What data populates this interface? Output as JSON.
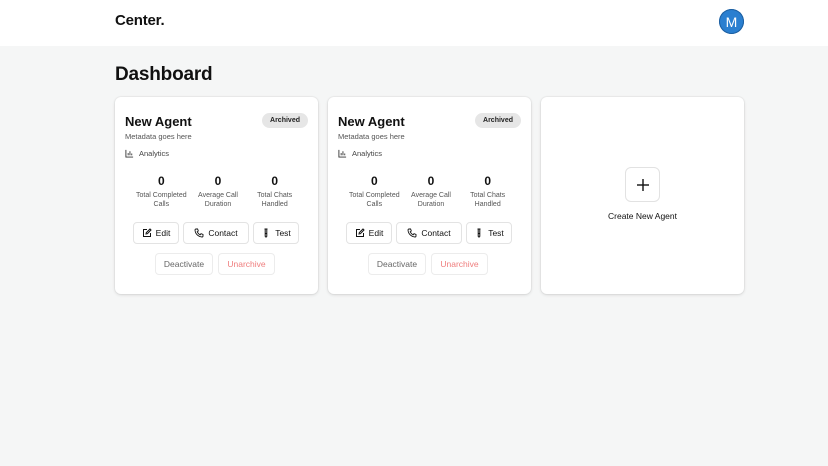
{
  "header": {
    "brand": "Center.",
    "avatar_initial": "M",
    "avatar_color": "#2a7fd0"
  },
  "page": {
    "title": "Dashboard"
  },
  "agents": [
    {
      "name": "New Agent",
      "metadata": "Metadata goes here",
      "badge": "Archived",
      "analytics_label": "Analytics",
      "stats": [
        {
          "value": "0",
          "label": "Total Completed Calls"
        },
        {
          "value": "0",
          "label": "Average Call Duration"
        },
        {
          "value": "0",
          "label": "Total Chats Handled"
        }
      ],
      "actions": {
        "edit": "Edit",
        "contact": "Contact",
        "test": "Test"
      },
      "secondary": {
        "deactivate": "Deactivate",
        "unarchive": "Unarchive"
      }
    },
    {
      "name": "New Agent",
      "metadata": "Metadata goes here",
      "badge": "Archived",
      "analytics_label": "Analytics",
      "stats": [
        {
          "value": "0",
          "label": "Total Completed Calls"
        },
        {
          "value": "0",
          "label": "Average Call Duration"
        },
        {
          "value": "0",
          "label": "Total Chats Handled"
        }
      ],
      "actions": {
        "edit": "Edit",
        "contact": "Contact",
        "test": "Test"
      },
      "secondary": {
        "deactivate": "Deactivate",
        "unarchive": "Unarchive"
      }
    }
  ],
  "create_card": {
    "label": "Create New Agent",
    "icon": "plus-icon"
  },
  "colors": {
    "background": "#f5f6f6",
    "unarchive": "#ef7d7d",
    "badge_bg": "#e6e6e6"
  }
}
